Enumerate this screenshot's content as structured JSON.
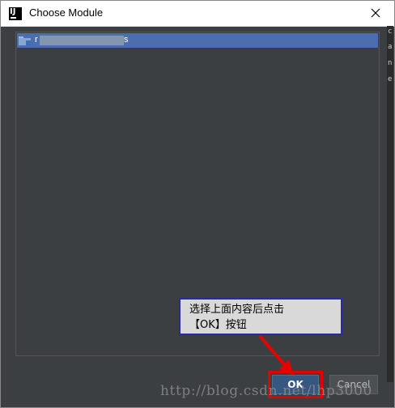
{
  "window": {
    "title": "Choose Module",
    "icon": "intellij-idea-icon",
    "close_icon": "close-icon"
  },
  "background_window": {
    "side_letters": [
      "c",
      "a",
      "n",
      "e"
    ]
  },
  "module_list": {
    "items": [
      {
        "name_prefix": "r",
        "name_suffix": "s",
        "selected": true,
        "icon": "module-folder-icon"
      }
    ],
    "selection_color": "#4b6eaf"
  },
  "annotation": {
    "line1": "选择上面内容后点击",
    "line2": "【OK】按钮",
    "border_color": "#2a2aa8",
    "arrow_color": "#e60000"
  },
  "buttons": {
    "ok_label": "OK",
    "cancel_label": "Cancel",
    "highlight_color": "#e60000"
  },
  "watermark": "http://blog.csdn.net/lhp3000",
  "colors": {
    "dialog_bg": "#3c3f41",
    "ok_bg": "#365880"
  }
}
